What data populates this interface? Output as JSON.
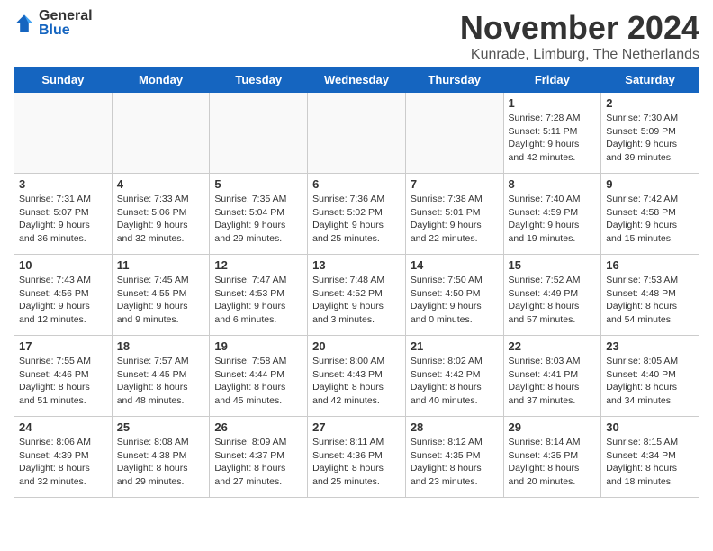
{
  "header": {
    "logo_general": "General",
    "logo_blue": "Blue",
    "month_title": "November 2024",
    "location": "Kunrade, Limburg, The Netherlands"
  },
  "days_of_week": [
    "Sunday",
    "Monday",
    "Tuesday",
    "Wednesday",
    "Thursday",
    "Friday",
    "Saturday"
  ],
  "weeks": [
    [
      {
        "day": "",
        "info": ""
      },
      {
        "day": "",
        "info": ""
      },
      {
        "day": "",
        "info": ""
      },
      {
        "day": "",
        "info": ""
      },
      {
        "day": "",
        "info": ""
      },
      {
        "day": "1",
        "info": "Sunrise: 7:28 AM\nSunset: 5:11 PM\nDaylight: 9 hours and 42 minutes."
      },
      {
        "day": "2",
        "info": "Sunrise: 7:30 AM\nSunset: 5:09 PM\nDaylight: 9 hours and 39 minutes."
      }
    ],
    [
      {
        "day": "3",
        "info": "Sunrise: 7:31 AM\nSunset: 5:07 PM\nDaylight: 9 hours and 36 minutes."
      },
      {
        "day": "4",
        "info": "Sunrise: 7:33 AM\nSunset: 5:06 PM\nDaylight: 9 hours and 32 minutes."
      },
      {
        "day": "5",
        "info": "Sunrise: 7:35 AM\nSunset: 5:04 PM\nDaylight: 9 hours and 29 minutes."
      },
      {
        "day": "6",
        "info": "Sunrise: 7:36 AM\nSunset: 5:02 PM\nDaylight: 9 hours and 25 minutes."
      },
      {
        "day": "7",
        "info": "Sunrise: 7:38 AM\nSunset: 5:01 PM\nDaylight: 9 hours and 22 minutes."
      },
      {
        "day": "8",
        "info": "Sunrise: 7:40 AM\nSunset: 4:59 PM\nDaylight: 9 hours and 19 minutes."
      },
      {
        "day": "9",
        "info": "Sunrise: 7:42 AM\nSunset: 4:58 PM\nDaylight: 9 hours and 15 minutes."
      }
    ],
    [
      {
        "day": "10",
        "info": "Sunrise: 7:43 AM\nSunset: 4:56 PM\nDaylight: 9 hours and 12 minutes."
      },
      {
        "day": "11",
        "info": "Sunrise: 7:45 AM\nSunset: 4:55 PM\nDaylight: 9 hours and 9 minutes."
      },
      {
        "day": "12",
        "info": "Sunrise: 7:47 AM\nSunset: 4:53 PM\nDaylight: 9 hours and 6 minutes."
      },
      {
        "day": "13",
        "info": "Sunrise: 7:48 AM\nSunset: 4:52 PM\nDaylight: 9 hours and 3 minutes."
      },
      {
        "day": "14",
        "info": "Sunrise: 7:50 AM\nSunset: 4:50 PM\nDaylight: 9 hours and 0 minutes."
      },
      {
        "day": "15",
        "info": "Sunrise: 7:52 AM\nSunset: 4:49 PM\nDaylight: 8 hours and 57 minutes."
      },
      {
        "day": "16",
        "info": "Sunrise: 7:53 AM\nSunset: 4:48 PM\nDaylight: 8 hours and 54 minutes."
      }
    ],
    [
      {
        "day": "17",
        "info": "Sunrise: 7:55 AM\nSunset: 4:46 PM\nDaylight: 8 hours and 51 minutes."
      },
      {
        "day": "18",
        "info": "Sunrise: 7:57 AM\nSunset: 4:45 PM\nDaylight: 8 hours and 48 minutes."
      },
      {
        "day": "19",
        "info": "Sunrise: 7:58 AM\nSunset: 4:44 PM\nDaylight: 8 hours and 45 minutes."
      },
      {
        "day": "20",
        "info": "Sunrise: 8:00 AM\nSunset: 4:43 PM\nDaylight: 8 hours and 42 minutes."
      },
      {
        "day": "21",
        "info": "Sunrise: 8:02 AM\nSunset: 4:42 PM\nDaylight: 8 hours and 40 minutes."
      },
      {
        "day": "22",
        "info": "Sunrise: 8:03 AM\nSunset: 4:41 PM\nDaylight: 8 hours and 37 minutes."
      },
      {
        "day": "23",
        "info": "Sunrise: 8:05 AM\nSunset: 4:40 PM\nDaylight: 8 hours and 34 minutes."
      }
    ],
    [
      {
        "day": "24",
        "info": "Sunrise: 8:06 AM\nSunset: 4:39 PM\nDaylight: 8 hours and 32 minutes."
      },
      {
        "day": "25",
        "info": "Sunrise: 8:08 AM\nSunset: 4:38 PM\nDaylight: 8 hours and 29 minutes."
      },
      {
        "day": "26",
        "info": "Sunrise: 8:09 AM\nSunset: 4:37 PM\nDaylight: 8 hours and 27 minutes."
      },
      {
        "day": "27",
        "info": "Sunrise: 8:11 AM\nSunset: 4:36 PM\nDaylight: 8 hours and 25 minutes."
      },
      {
        "day": "28",
        "info": "Sunrise: 8:12 AM\nSunset: 4:35 PM\nDaylight: 8 hours and 23 minutes."
      },
      {
        "day": "29",
        "info": "Sunrise: 8:14 AM\nSunset: 4:35 PM\nDaylight: 8 hours and 20 minutes."
      },
      {
        "day": "30",
        "info": "Sunrise: 8:15 AM\nSunset: 4:34 PM\nDaylight: 8 hours and 18 minutes."
      }
    ]
  ]
}
